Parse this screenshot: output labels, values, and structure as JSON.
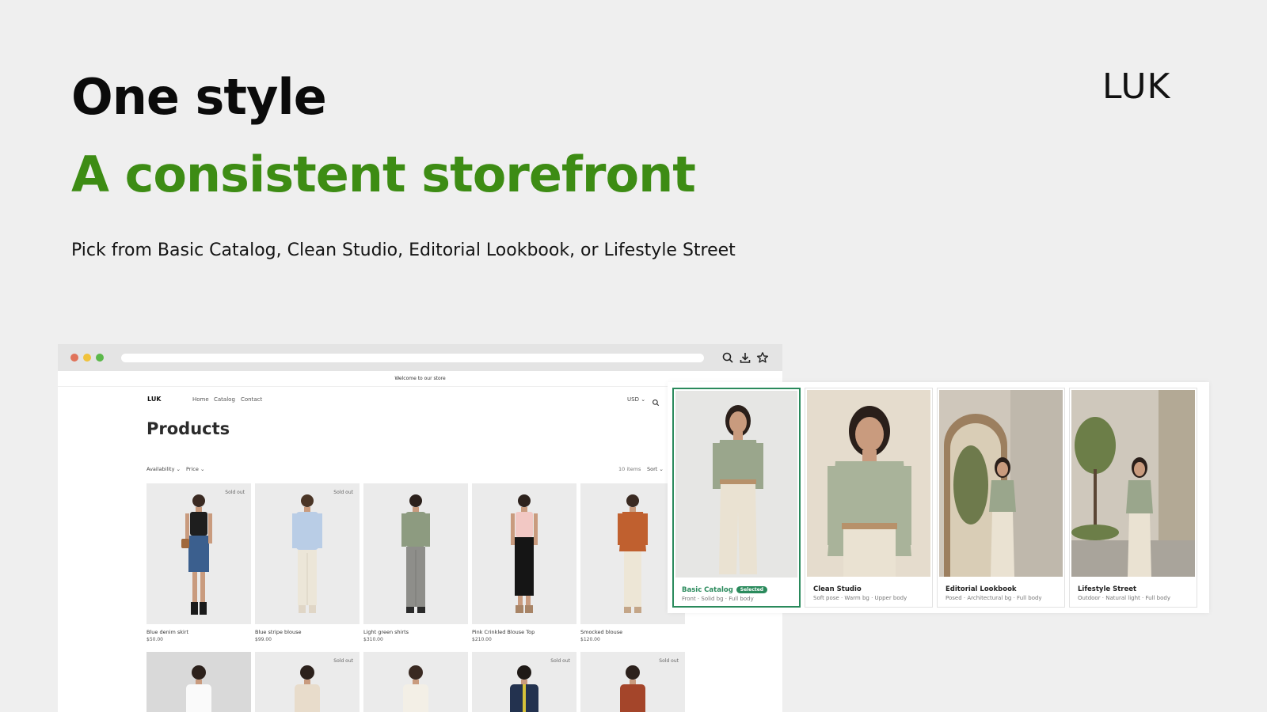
{
  "hero": {
    "line1": "One style",
    "line2": "A consistent storefront",
    "subtitle": "Pick from Basic Catalog, Clean Studio, Editorial Lookbook, or Lifestyle Street",
    "brand": "LUK"
  },
  "colors": {
    "accent_green": "#3d8c14",
    "selected_green": "#2a8a5c"
  },
  "browser": {
    "icons": [
      "search-icon",
      "download-icon",
      "star-icon"
    ],
    "announcement": "Welcome to our store",
    "nav": {
      "logo": "LUK",
      "links": [
        "Home",
        "Catalog",
        "Contact"
      ],
      "currency": "USD"
    },
    "page_title": "Products",
    "filters": {
      "availability": "Availability",
      "price": "Price",
      "count": "10 items",
      "sort": "Sort"
    },
    "products": [
      {
        "name": "Blue denim skirt",
        "price": "$50.00",
        "sold_out": "Sold out"
      },
      {
        "name": "Blue stripe blouse",
        "price": "$99.00",
        "sold_out": "Sold out"
      },
      {
        "name": "Light green shirts",
        "price": "$310.00",
        "sold_out": ""
      },
      {
        "name": "Pink Crinkled Blouse Top",
        "price": "$210.00",
        "sold_out": ""
      },
      {
        "name": "Smocked blouse",
        "price": "$120.00",
        "sold_out": ""
      },
      {
        "name": "",
        "price": "",
        "sold_out": ""
      },
      {
        "name": "",
        "price": "",
        "sold_out": "Sold out"
      },
      {
        "name": "",
        "price": "",
        "sold_out": ""
      },
      {
        "name": "",
        "price": "",
        "sold_out": "Sold out"
      },
      {
        "name": "",
        "price": "",
        "sold_out": "Sold out"
      }
    ]
  },
  "styles": [
    {
      "name": "Basic Catalog",
      "badge": "Selected",
      "desc": "Front · Solid bg · Full body"
    },
    {
      "name": "Clean Studio",
      "badge": "",
      "desc": "Soft pose · Warm bg · Upper body"
    },
    {
      "name": "Editorial Lookbook",
      "badge": "",
      "desc": "Posed · Architectural bg · Full body"
    },
    {
      "name": "Lifestyle Street",
      "badge": "",
      "desc": "Outdoor · Natural light · Full body"
    }
  ]
}
